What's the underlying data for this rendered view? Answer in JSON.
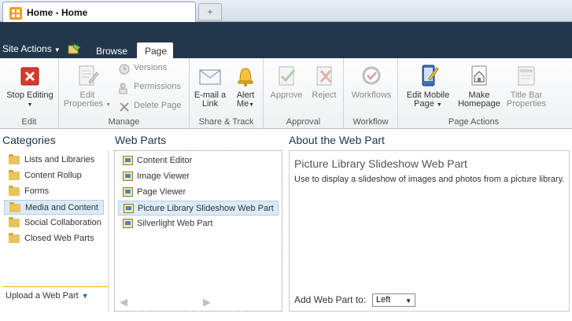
{
  "browser": {
    "tab_title": "Home - Home",
    "new_tab_glyph": "+"
  },
  "header": {
    "site_actions": "Site Actions",
    "ribbon_tabs": [
      {
        "label": "Browse"
      },
      {
        "label": "Page"
      }
    ]
  },
  "ribbon": {
    "groups": {
      "edit": {
        "label": "Edit",
        "stop_editing": "Stop Editing"
      },
      "manage": {
        "label": "Manage",
        "edit_properties_1": "Edit",
        "edit_properties_2": "Properties",
        "versions": "Versions",
        "permissions": "Permissions",
        "delete_page": "Delete Page"
      },
      "share_track": {
        "label": "Share & Track",
        "email_link_1": "E-mail a",
        "email_link_2": "Link",
        "alert_me_1": "Alert",
        "alert_me_2": "Me"
      },
      "approval": {
        "label": "Approval",
        "approve": "Approve",
        "reject": "Reject"
      },
      "workflow": {
        "label": "Workflow",
        "workflows": "Workflows"
      },
      "page_actions": {
        "label": "Page Actions",
        "edit_mobile_1": "Edit Mobile",
        "edit_mobile_2": "Page",
        "make_homepage_1": "Make",
        "make_homepage_2": "Homepage",
        "title_bar_1": "Title Bar",
        "title_bar_2": "Properties"
      }
    }
  },
  "categories": {
    "title": "Categories",
    "items": [
      {
        "label": "Lists and Libraries"
      },
      {
        "label": "Content Rollup"
      },
      {
        "label": "Forms"
      },
      {
        "label": "Media and Content",
        "selected": true
      },
      {
        "label": "Social Collaboration"
      },
      {
        "label": "Closed Web Parts"
      }
    ],
    "upload": "Upload a Web Part"
  },
  "web_parts": {
    "title": "Web Parts",
    "items": [
      {
        "label": "Content Editor"
      },
      {
        "label": "Image Viewer"
      },
      {
        "label": "Page Viewer"
      },
      {
        "label": "Picture Library Slideshow Web Part",
        "selected": true
      },
      {
        "label": "Silverlight Web Part"
      }
    ]
  },
  "about": {
    "title": "About the Web Part",
    "part_name": "Picture Library Slideshow Web Part",
    "description": "Use to display a slideshow of images and photos from a picture library.",
    "add_label": "Add Web Part to:",
    "zone_value": "Left"
  },
  "colors": {
    "header_bg": "#21374c",
    "selection_bg": "#dbebf7",
    "accent_gold": "#f0b400"
  }
}
